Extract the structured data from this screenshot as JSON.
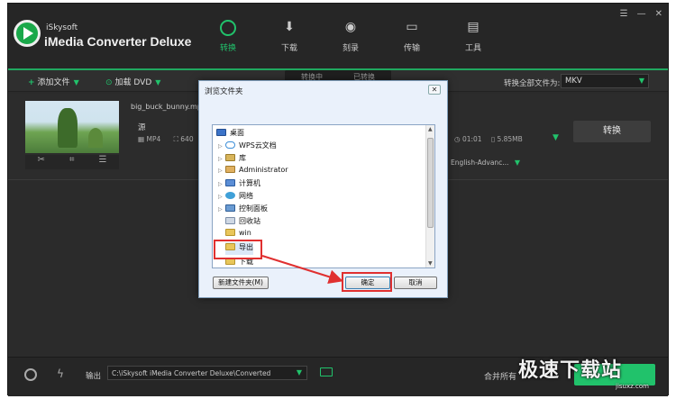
{
  "app": {
    "brand_small": "iSkysoft",
    "brand_name": "iMedia Converter Deluxe",
    "window_buttons": [
      "☰",
      "—",
      "✕"
    ]
  },
  "nav": {
    "items": [
      {
        "label": "转换",
        "icon": "convert-icon",
        "active": true
      },
      {
        "label": "下载",
        "icon": "download-icon",
        "active": false
      },
      {
        "label": "刻录",
        "icon": "burn-icon",
        "active": false
      },
      {
        "label": "传输",
        "icon": "transfer-icon",
        "active": false
      },
      {
        "label": "工具",
        "icon": "toolbox-icon",
        "active": false
      }
    ]
  },
  "toolbar": {
    "add_files": "添加文件",
    "load_dvd": "加载 DVD",
    "seg_left": "转换中",
    "seg_right": "已转换",
    "convert_all_to": "转换全部文件为:",
    "format": "MKV"
  },
  "file": {
    "name": "big_buck_bunny.mp4",
    "source_label": "源",
    "source_format": "MP4",
    "source_res": "640",
    "dest_duration": "01:01",
    "dest_size": "5.85MB",
    "subtitle": "English-Advanc...",
    "convert_button": "转换"
  },
  "bottom": {
    "output_label": "输出",
    "output_path": "C:\\iSkysoft iMedia Converter Deluxe\\Converted",
    "merge_label": "合并所有"
  },
  "watermark": {
    "text": "极速下载站",
    "sub": "jisuxz.com"
  },
  "dialog": {
    "title": "浏览文件夹",
    "close": "✕",
    "tree": [
      {
        "label": "桌面",
        "icon": "desktop",
        "indent": 0,
        "arrow": ""
      },
      {
        "label": "WPS云文档",
        "icon": "cloud",
        "indent": 1,
        "arrow": "▷"
      },
      {
        "label": "库",
        "icon": "library",
        "indent": 1,
        "arrow": "▷"
      },
      {
        "label": "Administrator",
        "icon": "user",
        "indent": 1,
        "arrow": "▷"
      },
      {
        "label": "计算机",
        "icon": "computer",
        "indent": 1,
        "arrow": "▷"
      },
      {
        "label": "网络",
        "icon": "network",
        "indent": 1,
        "arrow": "▷"
      },
      {
        "label": "控制面板",
        "icon": "control",
        "indent": 1,
        "arrow": "▷"
      },
      {
        "label": "回收站",
        "icon": "bin",
        "indent": 1,
        "arrow": ""
      },
      {
        "label": "win",
        "icon": "folder",
        "indent": 1,
        "arrow": ""
      },
      {
        "label": "导出",
        "icon": "folder",
        "indent": 1,
        "arrow": ""
      },
      {
        "label": "下载",
        "icon": "folder",
        "indent": 1,
        "arrow": ""
      }
    ],
    "new_folder": "新建文件夹(M)",
    "ok": "确定",
    "cancel": "取消"
  }
}
